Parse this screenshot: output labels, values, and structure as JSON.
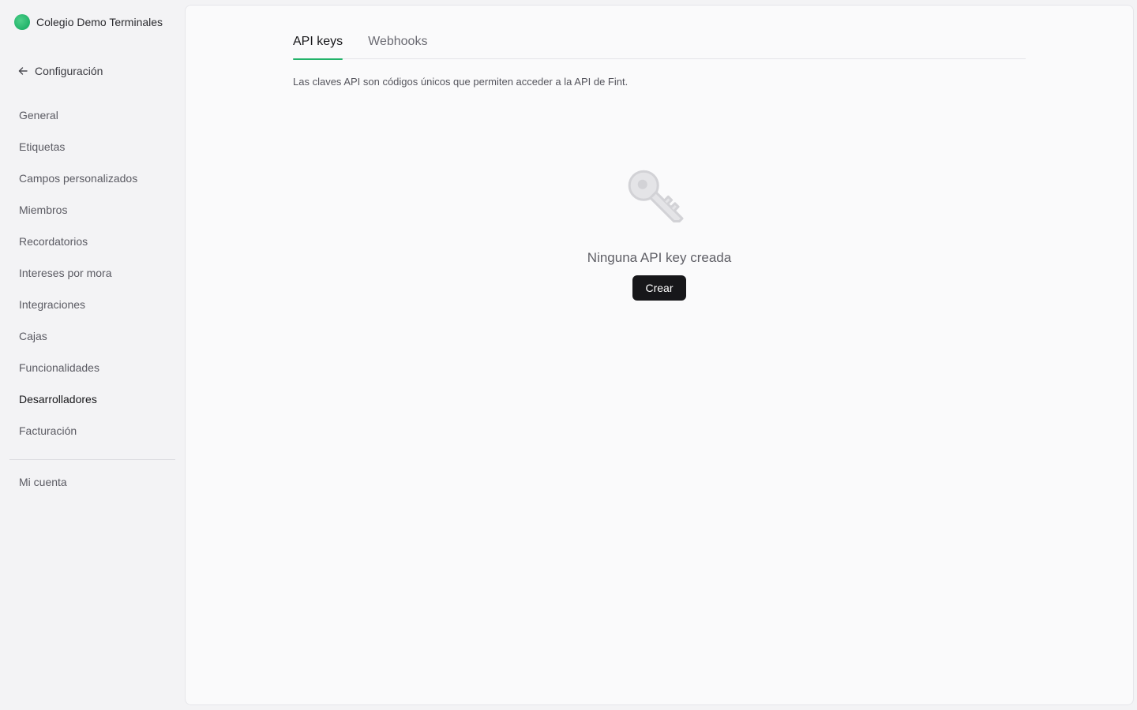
{
  "sidebar": {
    "org_name": "Colegio Demo Terminales",
    "back_label": "Configuración",
    "items": [
      {
        "label": "General"
      },
      {
        "label": "Etiquetas"
      },
      {
        "label": "Campos personalizados"
      },
      {
        "label": "Miembros"
      },
      {
        "label": "Recordatorios"
      },
      {
        "label": "Intereses por mora"
      },
      {
        "label": "Integraciones"
      },
      {
        "label": "Cajas"
      },
      {
        "label": "Funcionalidades"
      },
      {
        "label": "Desarrolladores",
        "active": true
      },
      {
        "label": "Facturación"
      }
    ],
    "account_label": "Mi cuenta"
  },
  "main": {
    "tabs": [
      {
        "label": "API keys",
        "active": true
      },
      {
        "label": "Webhooks",
        "active": false
      }
    ],
    "description": "Las claves API son códigos únicos que permiten acceder a la API de Fint.",
    "empty_state": {
      "icon": "key-icon",
      "title": "Ninguna API key creada",
      "button_label": "Crear"
    }
  },
  "colors": {
    "accent": "#22b36a",
    "button_bg": "#17171a",
    "background": "#f3f3f5",
    "panel": "#fafafb"
  }
}
